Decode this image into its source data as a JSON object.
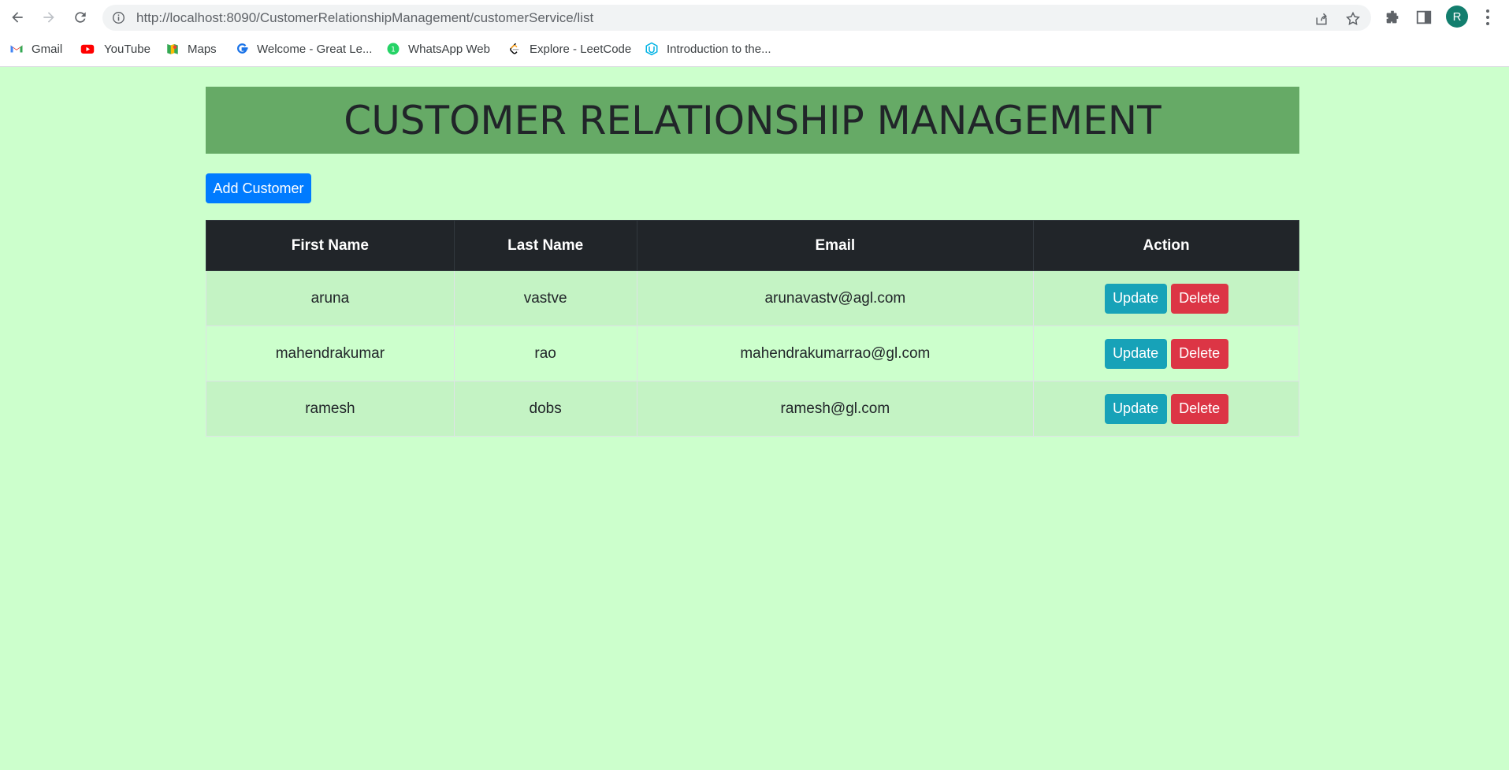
{
  "browser": {
    "url_host": "http://localhost",
    "url_rest": ":8090/CustomerRelationshipManagement/customerService/list",
    "avatar_letter": "R",
    "bookmarks": [
      {
        "label": "Gmail",
        "icon": "gmail-icon"
      },
      {
        "label": "YouTube",
        "icon": "youtube-icon"
      },
      {
        "label": "Maps",
        "icon": "maps-icon"
      },
      {
        "label": "Welcome - Great Le...",
        "icon": "greatlearning-icon"
      },
      {
        "label": "WhatsApp Web",
        "icon": "whatsapp-icon"
      },
      {
        "label": "Explore - LeetCode",
        "icon": "leetcode-icon"
      },
      {
        "label": "Introduction to the...",
        "icon": "udacity-icon"
      }
    ]
  },
  "page": {
    "title": "CUSTOMER RELATIONSHIP MANAGEMENT",
    "add_button": "Add Customer",
    "columns": [
      "First Name",
      "Last Name",
      "Email",
      "Action"
    ],
    "rows": [
      {
        "first": "aruna",
        "last": "vastve",
        "email": "arunavastv@agl.com"
      },
      {
        "first": "mahendrakumar",
        "last": "rao",
        "email": "mahendrakumarrao@gl.com"
      },
      {
        "first": "ramesh",
        "last": "dobs",
        "email": "ramesh@gl.com"
      }
    ],
    "update_label": "Update",
    "delete_label": "Delete"
  },
  "colors": {
    "page_bg": "#ccffcc",
    "banner_bg": "#66aa66",
    "header_bg": "#212529",
    "add_button": "#007bff",
    "update_button": "#17a2b8",
    "delete_button": "#dc3545"
  }
}
